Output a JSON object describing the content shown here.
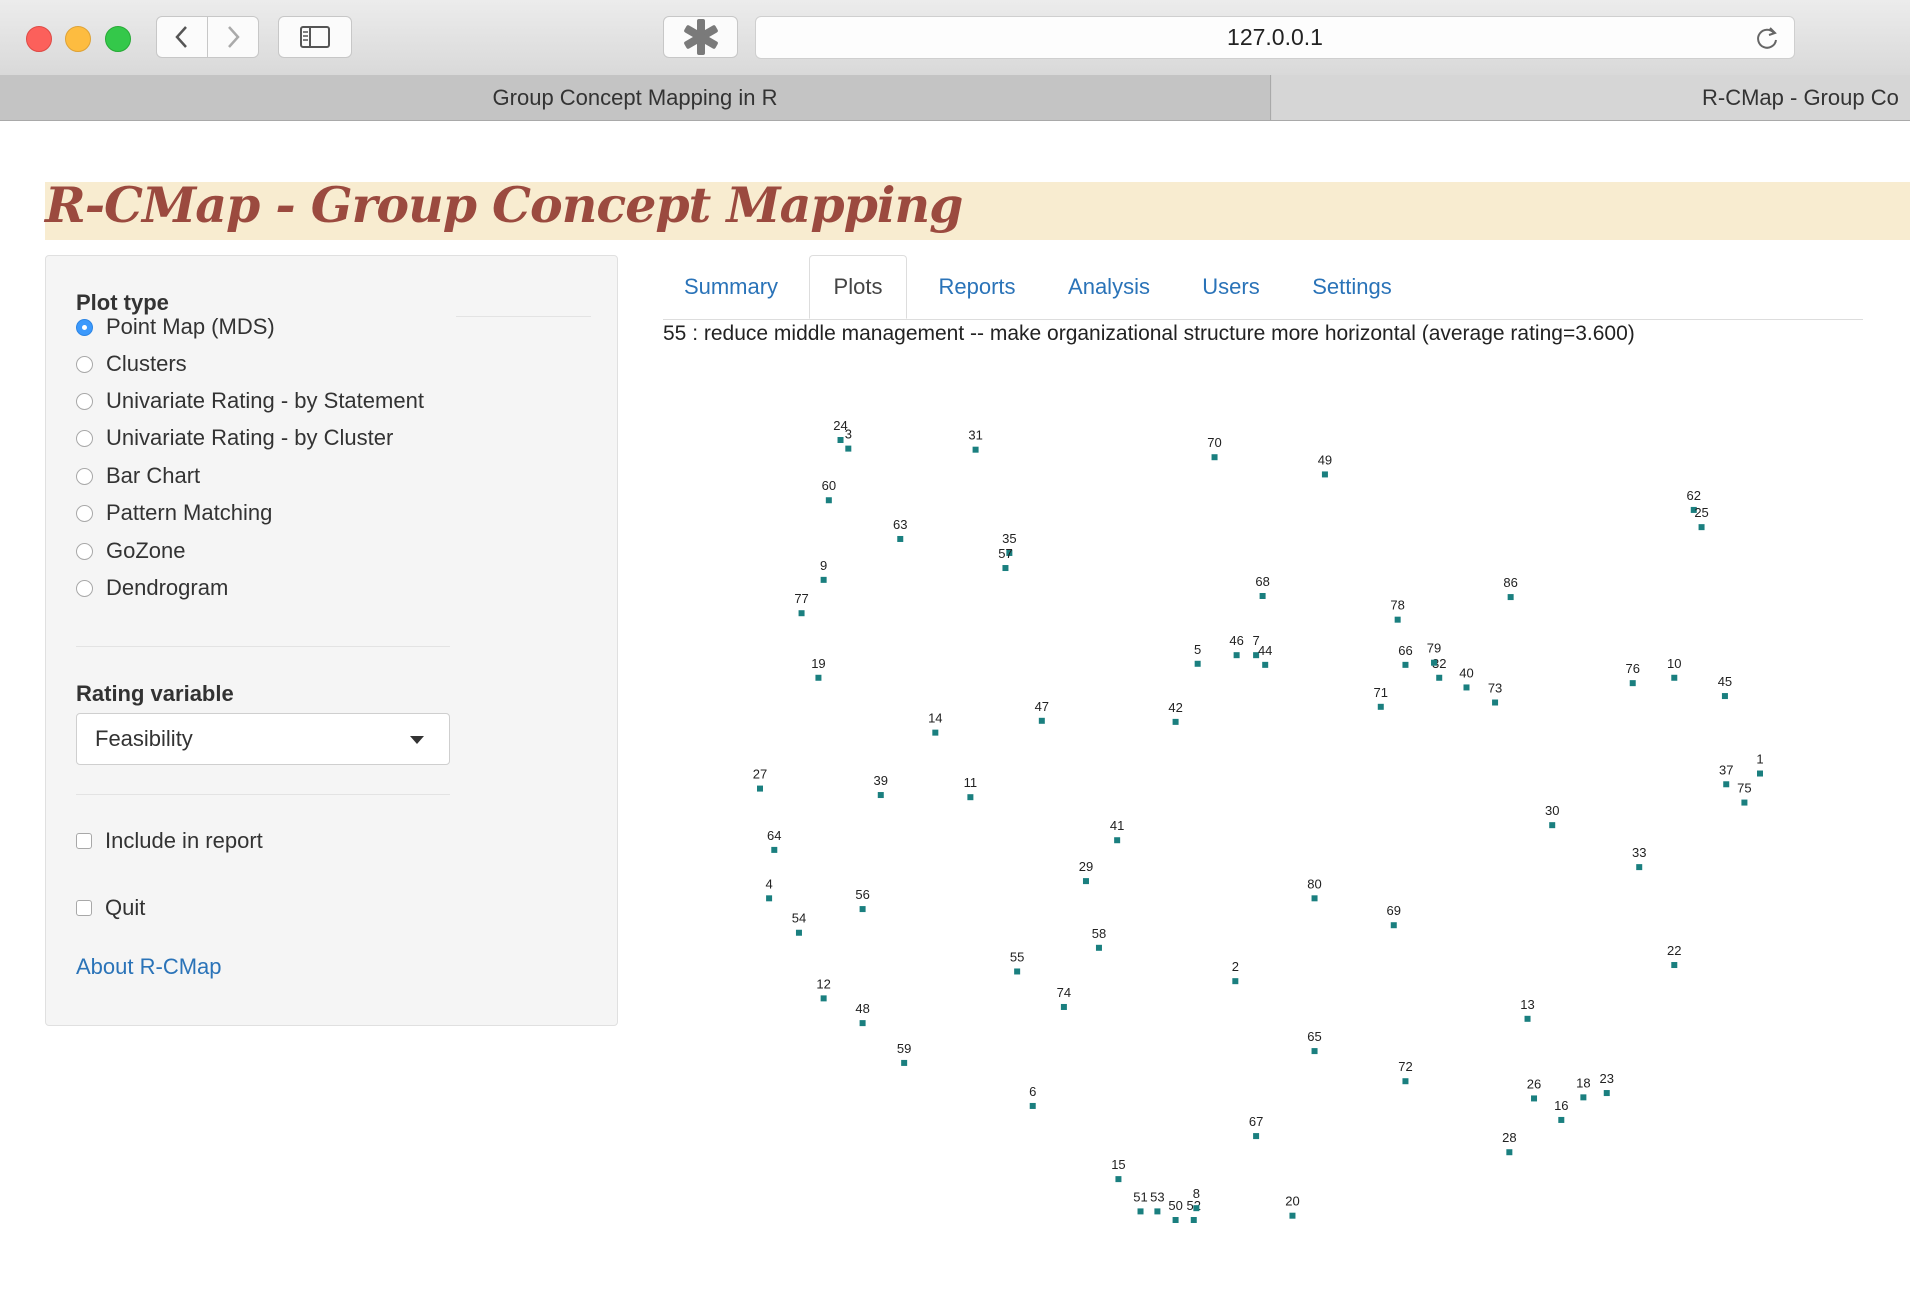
{
  "browser": {
    "url": "127.0.0.1",
    "tabs": [
      "Group Concept Mapping in R",
      "R-CMap - Group Co"
    ]
  },
  "page": {
    "title": "R-CMap - Group Concept Mapping"
  },
  "sidebar": {
    "plot_type_label": "Plot type",
    "plot_types": [
      {
        "label": "Point Map (MDS)",
        "selected": true
      },
      {
        "label": "Clusters",
        "selected": false
      },
      {
        "label": "Univariate Rating - by Statement",
        "selected": false
      },
      {
        "label": "Univariate Rating - by Cluster",
        "selected": false
      },
      {
        "label": "Bar Chart",
        "selected": false
      },
      {
        "label": "Pattern Matching",
        "selected": false
      },
      {
        "label": "GoZone",
        "selected": false
      },
      {
        "label": "Dendrogram",
        "selected": false
      }
    ],
    "rating_variable_label": "Rating variable",
    "rating_variable_value": "Feasibility",
    "include_in_report_label": "Include in report",
    "quit_label": "Quit",
    "about_link": "About R-CMap"
  },
  "main": {
    "tabs": [
      {
        "label": "Summary",
        "active": false
      },
      {
        "label": "Plots",
        "active": true
      },
      {
        "label": "Reports",
        "active": false
      },
      {
        "label": "Analysis",
        "active": false
      },
      {
        "label": "Users",
        "active": false
      },
      {
        "label": "Settings",
        "active": false
      }
    ],
    "hover_info": "55 : reduce middle management -- make organizational structure more horizontal (average rating=3.600)"
  },
  "chart_data": {
    "type": "scatter",
    "title": "",
    "xlabel": "",
    "ylabel": "",
    "grid": false,
    "axes": false,
    "point_color": "#1a7f7f",
    "points": [
      {
        "label": "5",
        "x": 0.417,
        "y": 0.073
      },
      {
        "label": "46",
        "x": 0.447,
        "y": 0.081
      },
      {
        "label": "7",
        "x": 0.462,
        "y": 0.081
      },
      {
        "label": "44",
        "x": 0.469,
        "y": 0.072
      },
      {
        "label": "68",
        "x": 0.467,
        "y": 0.136
      },
      {
        "label": "66",
        "x": 0.577,
        "y": 0.072
      },
      {
        "label": "32",
        "x": 0.603,
        "y": 0.06
      },
      {
        "label": "40",
        "x": 0.624,
        "y": 0.051
      },
      {
        "label": "86",
        "x": 0.658,
        "y": 0.135
      },
      {
        "label": "35",
        "x": 0.272,
        "y": 0.176
      },
      {
        "label": "70",
        "x": 0.43,
        "y": 0.265
      },
      {
        "label": "49",
        "x": 0.515,
        "y": 0.249
      },
      {
        "label": "24",
        "x": 0.142,
        "y": 0.281
      },
      {
        "label": "3",
        "x": 0.148,
        "y": 0.273
      },
      {
        "label": "31",
        "x": 0.246,
        "y": 0.272
      },
      {
        "label": "60",
        "x": 0.133,
        "y": 0.225
      },
      {
        "label": "63",
        "x": 0.188,
        "y": 0.189
      },
      {
        "label": "57",
        "x": 0.269,
        "y": 0.162
      },
      {
        "label": "62",
        "x": 0.799,
        "y": 0.216
      },
      {
        "label": "25",
        "x": 0.805,
        "y": 0.2
      },
      {
        "label": "9",
        "x": 0.129,
        "y": 0.151
      },
      {
        "label": "77",
        "x": 0.112,
        "y": 0.12
      },
      {
        "label": "78",
        "x": 0.571,
        "y": 0.114
      },
      {
        "label": "79",
        "x": 0.599,
        "y": 0.074
      },
      {
        "label": "19",
        "x": 0.125,
        "y": 0.06
      },
      {
        "label": "76",
        "x": 0.752,
        "y": 0.055
      },
      {
        "label": "10",
        "x": 0.784,
        "y": 0.06
      },
      {
        "label": "45",
        "x": 0.823,
        "y": 0.043
      },
      {
        "label": "73",
        "x": 0.646,
        "y": 0.037
      },
      {
        "label": "71",
        "x": 0.558,
        "y": 0.033
      },
      {
        "label": "42",
        "x": 0.4,
        "y": 0.019
      },
      {
        "label": "47",
        "x": 0.297,
        "y": 0.02
      },
      {
        "label": "14",
        "x": 0.215,
        "y": 0.009
      },
      {
        "label": "1",
        "x": 0.85,
        "y": -0.029
      },
      {
        "label": "37",
        "x": 0.824,
        "y": -0.039
      },
      {
        "label": "75",
        "x": 0.838,
        "y": -0.056
      },
      {
        "label": "27",
        "x": 0.08,
        "y": -0.043
      },
      {
        "label": "39",
        "x": 0.173,
        "y": -0.049
      },
      {
        "label": "11",
        "x": 0.242,
        "y": -0.051
      },
      {
        "label": "30",
        "x": 0.69,
        "y": -0.077
      },
      {
        "label": "41",
        "x": 0.355,
        "y": -0.091
      },
      {
        "label": "33",
        "x": 0.757,
        "y": -0.116
      },
      {
        "label": "64",
        "x": 0.091,
        "y": -0.1
      },
      {
        "label": "29",
        "x": 0.331,
        "y": -0.129
      },
      {
        "label": "80",
        "x": 0.507,
        "y": -0.145
      },
      {
        "label": "4",
        "x": 0.087,
        "y": -0.145
      },
      {
        "label": "56",
        "x": 0.159,
        "y": -0.155
      },
      {
        "label": "69",
        "x": 0.568,
        "y": -0.17
      },
      {
        "label": "54",
        "x": 0.11,
        "y": -0.177
      },
      {
        "label": "58",
        "x": 0.341,
        "y": -0.191
      },
      {
        "label": "22",
        "x": 0.784,
        "y": -0.207
      },
      {
        "label": "55",
        "x": 0.278,
        "y": -0.213
      },
      {
        "label": "2",
        "x": 0.446,
        "y": -0.222
      },
      {
        "label": "12",
        "x": 0.129,
        "y": -0.238
      },
      {
        "label": "74",
        "x": 0.314,
        "y": -0.246
      },
      {
        "label": "13",
        "x": 0.671,
        "y": -0.257
      },
      {
        "label": "48",
        "x": 0.159,
        "y": -0.261
      },
      {
        "label": "65",
        "x": 0.507,
        "y": -0.287
      },
      {
        "label": "59",
        "x": 0.191,
        "y": -0.298
      },
      {
        "label": "72",
        "x": 0.577,
        "y": -0.315
      },
      {
        "label": "26",
        "x": 0.676,
        "y": -0.331
      },
      {
        "label": "18",
        "x": 0.714,
        "y": -0.33
      },
      {
        "label": "23",
        "x": 0.732,
        "y": -0.326
      },
      {
        "label": "16",
        "x": 0.697,
        "y": -0.351
      },
      {
        "label": "6",
        "x": 0.29,
        "y": -0.338
      },
      {
        "label": "67",
        "x": 0.462,
        "y": -0.366
      },
      {
        "label": "28",
        "x": 0.657,
        "y": -0.381
      },
      {
        "label": "15",
        "x": 0.356,
        "y": -0.406
      },
      {
        "label": "20",
        "x": 0.49,
        "y": -0.44
      },
      {
        "label": "51",
        "x": 0.373,
        "y": -0.436
      },
      {
        "label": "53",
        "x": 0.386,
        "y": -0.436
      },
      {
        "label": "50",
        "x": 0.4,
        "y": -0.444
      },
      {
        "label": "52",
        "x": 0.414,
        "y": -0.444
      },
      {
        "label": "8",
        "x": 0.416,
        "y": -0.433
      }
    ]
  }
}
